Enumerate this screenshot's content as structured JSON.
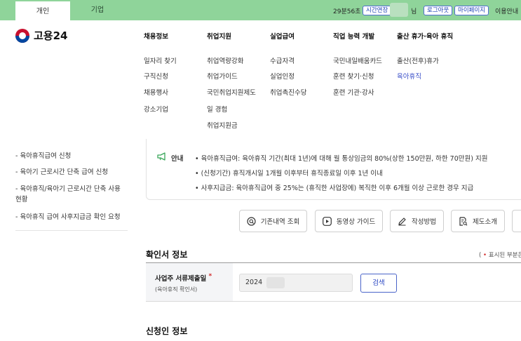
{
  "topbar": {
    "tabs": [
      "개인",
      "기업"
    ],
    "timer": "29분56초",
    "extend_label": "시간연장",
    "user_suffix": "님",
    "logout_label": "로그아웃",
    "mypage_label": "마이페이지",
    "guide_label": "이용안내"
  },
  "brand": {
    "name": "고용24"
  },
  "menu": [
    {
      "heading": "채용정보",
      "items": [
        "일자리 찾기",
        "구직신청",
        "채용행사",
        "강소기업"
      ]
    },
    {
      "heading": "취업지원",
      "items": [
        "취업역량강화",
        "취업가이드",
        "국민취업지원제도",
        "일 경험",
        "취업지원금"
      ]
    },
    {
      "heading": "실업급여",
      "items": [
        "수급자격",
        "실업인정",
        "취업촉진수당"
      ]
    },
    {
      "heading": "직업 능력 개발",
      "items": [
        "국민내일배움카드",
        "훈련 찾기·신청",
        "훈련 기관·강사"
      ]
    },
    {
      "heading": "출산 휴가·육아 휴직",
      "items": [
        "출산(전후)휴가",
        "육아휴직"
      ],
      "active_index": 1
    }
  ],
  "sidebar": {
    "items": [
      "- 육아휴직급여 신청",
      "- 육아기 근로시간 단축 급여 신청",
      "- 육아휴직/육아기 근로시간 단축 사용 현황",
      "- 육아휴직 급여 사후지급금 확인 요청"
    ]
  },
  "notice": {
    "label": "안내",
    "lines": [
      "• 육아휴직급여: 육아휴직 기간(최대 1년)에 대해 월 통상임금의 80%(상한 150만원, 하한 70만원) 지원",
      "• (신청기간) 휴직개시일 1개월 이후부터 휴직종료일 이후 1년 이내",
      "• 사후지급금: 육아휴직급여 중 25%는 (휴직한 사업장에) 복직한 이후 6개월 이상 근로한 경우 지급"
    ]
  },
  "actions": {
    "history": "기존내역 조회",
    "video": "동영상 가이드",
    "how_to": "작성방법",
    "intro": "제도소개"
  },
  "confirm_section": {
    "title": "확인서 정보",
    "required_note": "표시된 부분은",
    "field_label": "사업주 서류제출일",
    "field_sub": "(육아휴직 확인서)",
    "field_value": "2024",
    "search_label": "검색"
  },
  "applicant_section": {
    "title": "신청인 정보"
  },
  "colors": {
    "topbar": "#8fd49a",
    "accent": "#3a4fc8",
    "required": "#d12c2c"
  }
}
